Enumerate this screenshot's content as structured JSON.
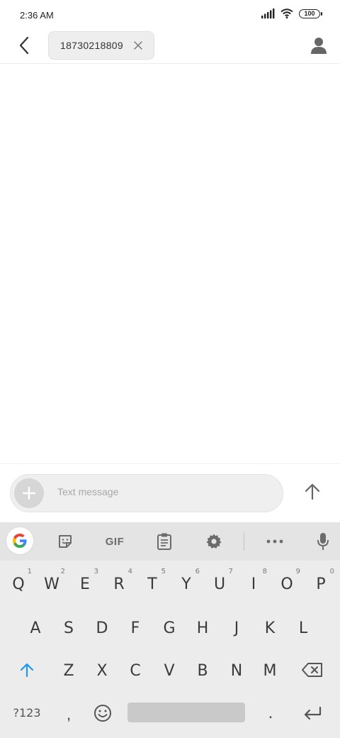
{
  "status_bar": {
    "time": "2:36 AM",
    "battery": "100",
    "icons": [
      "signal-icon",
      "wifi-icon",
      "battery-icon"
    ]
  },
  "header": {
    "recipient_chip": "18730218809",
    "back_icon": "chevron-left-icon",
    "chip_remove_icon": "close-icon",
    "contact_icon": "person-icon"
  },
  "compose": {
    "placeholder": "Text message",
    "attach_icon": "plus-icon",
    "send_icon": "arrow-up-icon"
  },
  "keyboard": {
    "toolbar": {
      "google_icon": "google-g-icon",
      "sticker_icon": "sticker-icon",
      "gif_label": "GIF",
      "clipboard_icon": "clipboard-icon",
      "settings_icon": "gear-icon",
      "more_icon": "more-icon",
      "mic_icon": "mic-icon"
    },
    "row1": [
      "Q",
      "W",
      "E",
      "R",
      "T",
      "Y",
      "U",
      "I",
      "O",
      "P"
    ],
    "row1_hints": [
      "1",
      "2",
      "3",
      "4",
      "5",
      "6",
      "7",
      "8",
      "9",
      "0"
    ],
    "row2": [
      "A",
      "S",
      "D",
      "F",
      "G",
      "H",
      "J",
      "K",
      "L"
    ],
    "row3": [
      "Z",
      "X",
      "C",
      "V",
      "B",
      "N",
      "M"
    ],
    "symbols_label": "?123",
    "comma": ",",
    "period": ".",
    "accent_color": "#2196F3"
  }
}
